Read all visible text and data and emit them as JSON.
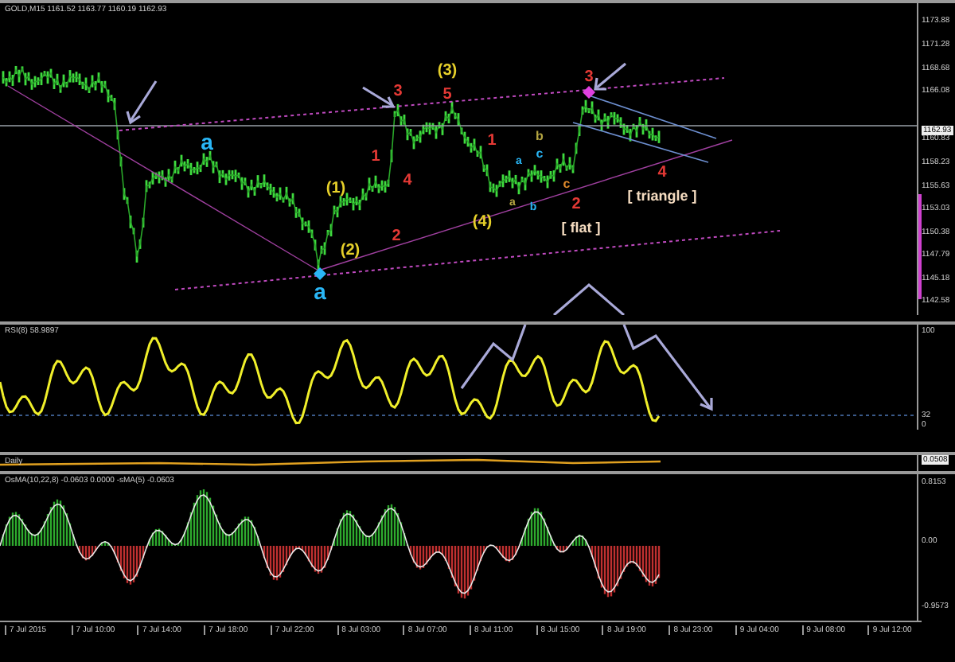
{
  "main_panel": {
    "title": "GOLD,M15  1161.52 1163.77 1160.19 1162.93",
    "price_axis": [
      {
        "label": "1173.88",
        "kind": "tick"
      },
      {
        "label": "1171.28",
        "kind": "tick"
      },
      {
        "label": "1168.68",
        "kind": "tick"
      },
      {
        "label": "1166.08",
        "kind": "tick"
      },
      {
        "label": "1162.93",
        "kind": "current"
      },
      {
        "label": "1160.83",
        "kind": "tick"
      },
      {
        "label": "1158.23",
        "kind": "tick"
      },
      {
        "label": "1155.63",
        "kind": "tick"
      },
      {
        "label": "1153.03",
        "kind": "tick"
      },
      {
        "label": "1150.38",
        "kind": "tick"
      },
      {
        "label": "1147.79",
        "kind": "tick"
      },
      {
        "label": "1145.18",
        "kind": "tick"
      },
      {
        "label": "1142.58",
        "kind": "tick"
      }
    ],
    "wave_labels": [
      {
        "text": "a",
        "color": "#29b6f6"
      },
      {
        "text": "a",
        "color": "#29b6f6"
      },
      {
        "text": "(1)",
        "color": "#e6d02a"
      },
      {
        "text": "(2)",
        "color": "#e6d02a"
      },
      {
        "text": "1",
        "color": "#e53935"
      },
      {
        "text": "2",
        "color": "#e53935"
      },
      {
        "text": "3",
        "color": "#e53935"
      },
      {
        "text": "4",
        "color": "#e53935"
      },
      {
        "text": "(3)",
        "color": "#e6d02a"
      },
      {
        "text": "5",
        "color": "#e53935"
      },
      {
        "text": "1",
        "color": "#e53935"
      },
      {
        "text": "(4)",
        "color": "#e6d02a"
      },
      {
        "text": "b",
        "color": "#b5a642"
      },
      {
        "text": "a",
        "color": "#29b6f6"
      },
      {
        "text": "c",
        "color": "#29b6f6"
      },
      {
        "text": "a",
        "color": "#b5a642"
      },
      {
        "text": "b",
        "color": "#29b6f6"
      },
      {
        "text": "c",
        "color": "#e08a2c"
      },
      {
        "text": "2",
        "color": "#e53935"
      },
      {
        "text": "3",
        "color": "#e53935"
      },
      {
        "text": "4",
        "color": "#e53935"
      },
      {
        "text": "[ flat ]",
        "color": "#f5dcc0"
      },
      {
        "text": "[ triangle ]",
        "color": "#f5dcc0"
      }
    ]
  },
  "rsi_panel": {
    "title": "RSI(8) 58.9897",
    "axis": [
      "100",
      "32",
      "0"
    ]
  },
  "daily_panel": {
    "title": "Daily",
    "axis": [
      "0.0508"
    ]
  },
  "osma_panel": {
    "title": "OsMA(10,22,8) -0.0603 0.0000 -sMA(5) -0.0603",
    "axis": [
      "0.8153",
      "0.00",
      "-0.9573"
    ]
  },
  "time_axis": [
    "7 Jul 2015",
    "7 Jul 10:00",
    "7 Jul 14:00",
    "7 Jul 18:00",
    "7 Jul 22:00",
    "8 Jul 03:00",
    "8 Jul 07:00",
    "8 Jul 11:00",
    "8 Jul 15:00",
    "8 Jul 19:00",
    "8 Jul 23:00",
    "9 Jul 04:00",
    "9 Jul 08:00",
    "9 Jul 12:00"
  ]
}
